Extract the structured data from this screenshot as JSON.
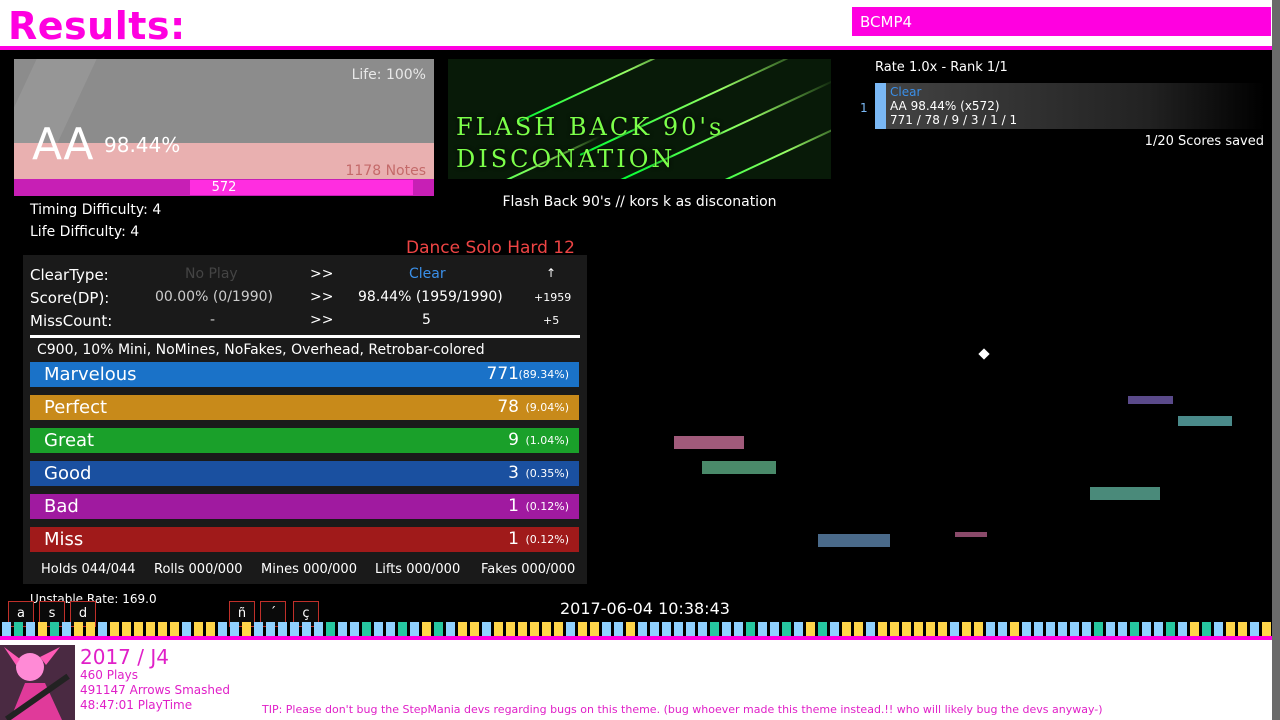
{
  "header": {
    "title": "Results:",
    "profile_name": "BCMP4"
  },
  "grade": {
    "life": "Life: 100%",
    "grade": "AA",
    "percent": "98.44%",
    "notes": "1178 Notes",
    "max_combo": "572",
    "combo_fraction": 0.53
  },
  "difficulty": {
    "timing": "Timing Difficulty: 4",
    "life": "Life Difficulty: 4",
    "chart": "Dance Solo Hard 12"
  },
  "banner": {
    "line1": "FLASH BACK 90's",
    "line2": "DISCONATION"
  },
  "song": {
    "title": "Flash Back 90's // kors k as disconation"
  },
  "scores": {
    "rate_rank": "Rate 1.0x - Rank 1/1",
    "index": "1",
    "clear": "Clear",
    "line2": "AA 98.44% (x572)",
    "line3": "771 / 78 / 9 / 3 / 1 / 1",
    "saved": "1/20 Scores saved"
  },
  "comparison": {
    "rows": [
      {
        "label": "ClearType:",
        "old": "No Play",
        "arrow": ">>",
        "new": "Clear",
        "diff": "↑"
      },
      {
        "label": "Score(DP):",
        "old": "00.00% (0/1990)",
        "arrow": ">>",
        "new": "98.44% (1959/1990)",
        "diff": "+1959"
      },
      {
        "label": "MissCount:",
        "old": "-",
        "arrow": ">>",
        "new": "5",
        "diff": "+5"
      }
    ]
  },
  "mods": "C900, 10% Mini, NoMines, NoFakes, Overhead, Retrobar-colored",
  "judgements": [
    {
      "label": "Marvelous",
      "count": "771",
      "pct": "(89.34%)",
      "color": "#1a72c8"
    },
    {
      "label": "Perfect",
      "count": "78",
      "pct": "(9.04%)",
      "color": "#c88a1a"
    },
    {
      "label": "Great",
      "count": "9",
      "pct": "(1.04%)",
      "color": "#1aa02a"
    },
    {
      "label": "Good",
      "count": "3",
      "pct": "(0.35%)",
      "color": "#1a50a0"
    },
    {
      "label": "Bad",
      "count": "1",
      "pct": "(0.12%)",
      "color": "#a01aa0"
    },
    {
      "label": "Miss",
      "count": "1",
      "pct": "(0.12%)",
      "color": "#a01a1a"
    }
  ],
  "stats": {
    "holds": "Holds 044/044",
    "rolls": "Rolls 000/000",
    "mines": "Mines 000/000",
    "lifts": "Lifts 000/000",
    "fakes": "Fakes 000/000"
  },
  "unstable_rate": "Unstable Rate: 169.0",
  "date": "2017-06-04 10:38:43",
  "keys": [
    "a",
    "s",
    "d",
    "ñ",
    "´",
    "ç"
  ],
  "footer": {
    "year": "2017 / J4",
    "plays": "460 Plays",
    "arrows": "491147 Arrows Smashed",
    "playtime": "48:47:01 PlayTime",
    "tip": "TIP: Please don't bug the StepMania devs regarding bugs on this theme. (bug whoever made this theme instead.!! who will likely bug the devs anyway-)"
  },
  "colors": {
    "accent": "#ff00e0",
    "clear": "#3a8fe8",
    "difficulty": "#ee4444"
  }
}
